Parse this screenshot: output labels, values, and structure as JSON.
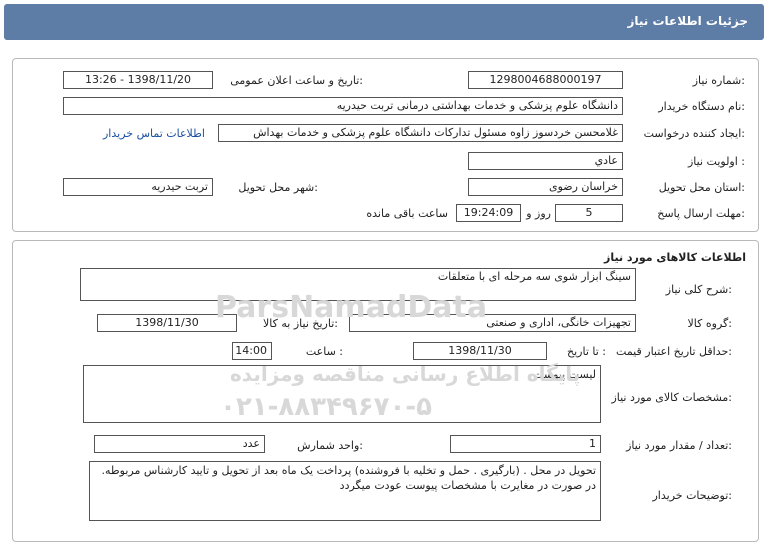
{
  "header": {
    "title": "جزئیات اطلاعات نیاز"
  },
  "general": {
    "need_number_label": "شماره نیاز:",
    "need_number": "1298004688000197",
    "announce_label": "تاریخ و ساعت اعلان عمومی:",
    "announce_value": "1398/11/20 - 13:26",
    "buyer_org_label": "نام دستگاه خریدار:",
    "buyer_org": "دانشگاه علوم پزشکی و خدمات بهداشتی درمانی تربت حیدریه",
    "creator_label": "ایجاد کننده درخواست:",
    "creator": "غلامحسن خردسوز زاوه مسئول تدارکات دانشگاه علوم پزشکی و خدمات بهداش",
    "contact_link": "اطلاعات تماس خریدار",
    "priority_label": "اولویت نیاز :",
    "priority": "عادي",
    "province_label": "استان محل تحویل:",
    "province": "خراسان رضوی",
    "city_label": "شهر محل تحویل:",
    "city": "تربت حیدریه",
    "deadline_label": "مهلت ارسال پاسخ:",
    "days": "5",
    "days_word": "روز و",
    "time_remaining": "19:24:09",
    "remaining_word": "ساعت باقی مانده"
  },
  "goods": {
    "section_title": "اطلاعات کالاهای مورد نیاز",
    "desc_label": "شرح کلی نیاز:",
    "desc": "سینگ ابزار شوی سه مرحله ای با متعلقات",
    "group_label": "گروه کالا:",
    "group": "تجهیزات خانگی، اداری و صنعتی",
    "need_date_label": "تاریخ نیاز به کالا:",
    "need_date": "1398/11/30",
    "validity_label": "حداقل تاریخ اعتبار قیمت:",
    "until_label": "تا تاریخ :",
    "validity_date": "1398/11/30",
    "hour_label": "ساعت :",
    "validity_time": "14:00",
    "specs_label": "مشخصات کالای مورد نیاز:",
    "specs": "لیست پیوست",
    "qty_label": "تعداد / مقدار مورد نیاز:",
    "qty": "1",
    "unit_label": "واحد شمارش:",
    "unit": "عدد",
    "notes_label": "توضیحات خریدار:",
    "notes": "تحویل در محل . (بارگیری . حمل و تخلیه با فروشنده) پرداخت یک ماه بعد از تحویل و تایید کارشناس مربوطه. در صورت در مغایرت با مشخصات پیوست  عودت میگردد"
  },
  "watermark": {
    "brand": "ParsNamadData",
    "line1": "پایگاه اطلاع رسانی مناقصه ومزایده",
    "line2": "۰۲۱-۸۸۳۴۹۶۷۰-۵"
  }
}
